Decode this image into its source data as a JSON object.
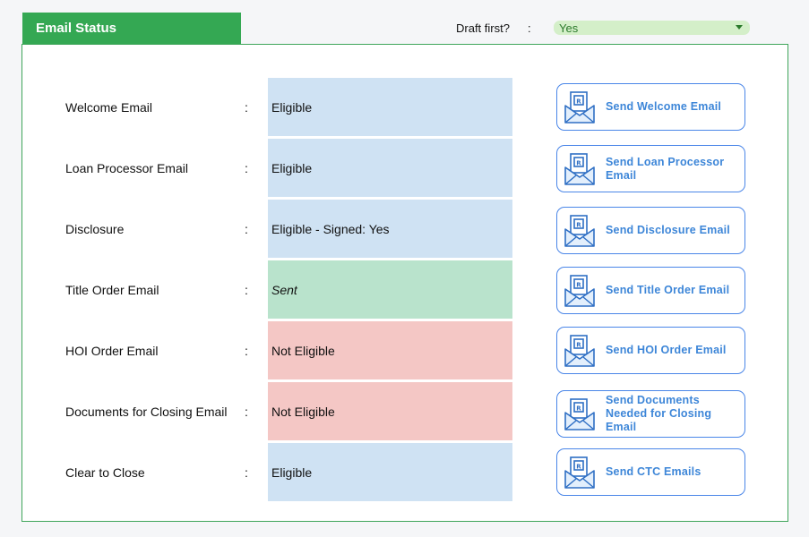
{
  "header": {
    "title": "Email Status",
    "draft_label": "Draft first?",
    "draft_colon": ":",
    "draft_value": "Yes"
  },
  "rows": [
    {
      "label": "Welcome Email",
      "colon": ":",
      "status": "Eligible",
      "status_type": "eligible",
      "button": "Send Welcome Email"
    },
    {
      "label": "Loan Processor Email",
      "colon": ":",
      "status": "Eligible",
      "status_type": "eligible",
      "button": "Send Loan Processor Email"
    },
    {
      "label": "Disclosure",
      "colon": ":",
      "status": "Eligible - Signed: Yes",
      "status_type": "eligible",
      "button": "Send Disclosure Email"
    },
    {
      "label": "Title Order Email",
      "colon": ":",
      "status": "Sent",
      "status_type": "sent",
      "button": "Send Title Order Email"
    },
    {
      "label": "HOI Order Email",
      "colon": ":",
      "status": "Not Eligible",
      "status_type": "not",
      "button": "Send HOI Order Email"
    },
    {
      "label": "Documents for Closing Email",
      "colon": ":",
      "status": "Not Eligible",
      "status_type": "not",
      "button": "Send Documents Needed for Closing Email"
    },
    {
      "label": "Clear to Close",
      "colon": ":",
      "status": "Eligible",
      "status_type": "eligible",
      "button": "Send CTC Emails"
    }
  ],
  "colors": {
    "header_green": "#34a853",
    "eligible_bg": "#cfe2f3",
    "sent_bg": "#b9e3cc",
    "not_eligible_bg": "#f4c7c5",
    "button_border": "#4a86e8",
    "button_text": "#3d86d8"
  },
  "icons": {
    "send_button_icon": "envelope-document-icon"
  }
}
